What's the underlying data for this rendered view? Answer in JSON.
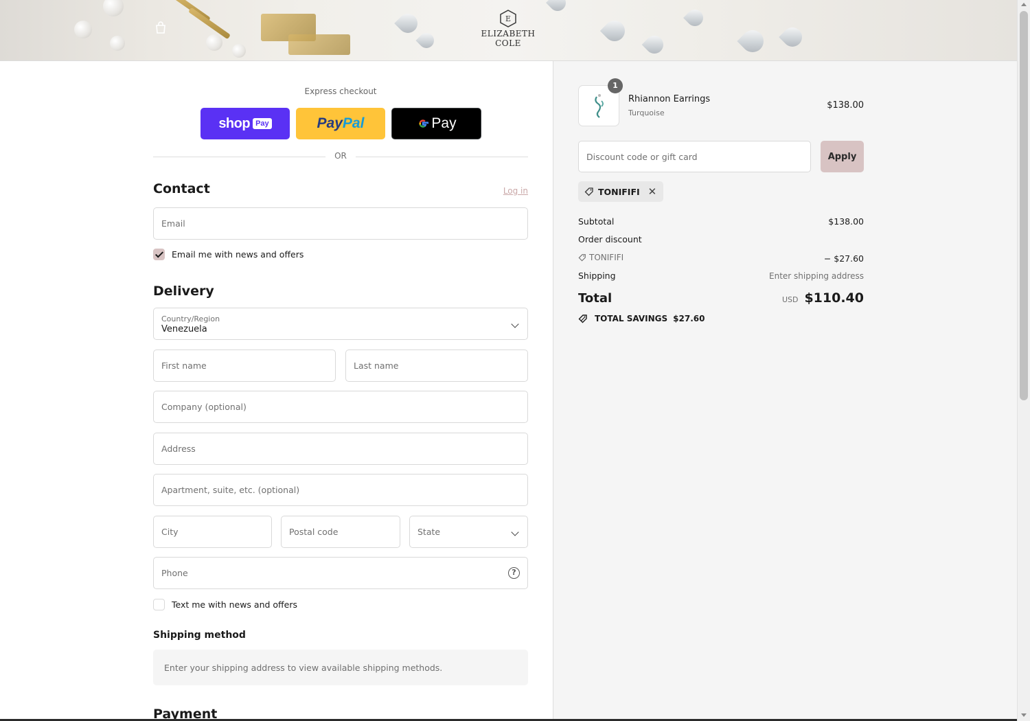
{
  "header": {
    "brand_name": "ELIZABETH COLE",
    "cart_icon": "shopping-bag-icon",
    "logo_icon": "hexagon-monogram-icon"
  },
  "express_checkout": {
    "label": "Express checkout",
    "shop_pay": {
      "text": "shop",
      "pill": "Pay"
    },
    "paypal": {
      "part1": "Pay",
      "part2": "Pal"
    },
    "google_pay": {
      "g": "G",
      "pay": "Pay"
    },
    "divider_text": "OR"
  },
  "contact": {
    "title": "Contact",
    "login_link": "Log in",
    "email_placeholder": "Email",
    "email_offers_label": "Email me with news and offers",
    "email_offers_checked": true
  },
  "delivery": {
    "title": "Delivery",
    "country_label": "Country/Region",
    "country_value": "Venezuela",
    "first_name_placeholder": "First name",
    "last_name_placeholder": "Last name",
    "company_placeholder": "Company (optional)",
    "address_placeholder": "Address",
    "apartment_placeholder": "Apartment, suite, etc. (optional)",
    "city_placeholder": "City",
    "postal_placeholder": "Postal code",
    "state_placeholder": "State",
    "phone_placeholder": "Phone",
    "phone_help_glyph": "?",
    "text_offers_label": "Text me with news and offers",
    "text_offers_checked": false
  },
  "shipping_method": {
    "title": "Shipping method",
    "message": "Enter your shipping address to view available shipping methods."
  },
  "payment": {
    "title": "Payment"
  },
  "order": {
    "item": {
      "name": "Rhiannon Earrings",
      "variant": "Turquoise",
      "price": "$138.00",
      "quantity": "1"
    },
    "discount_placeholder": "Discount code or gift card",
    "apply_label": "Apply",
    "applied_code": "TONIFIFI",
    "subtotal_label": "Subtotal",
    "subtotal_value": "$138.00",
    "order_discount_label": "Order discount",
    "discount_code": "TONIFIFI",
    "discount_value": "− $27.60",
    "shipping_label": "Shipping",
    "shipping_value": "Enter shipping address",
    "total_label": "Total",
    "currency": "USD",
    "total_value": "$110.40",
    "savings_label": "TOTAL SAVINGS",
    "savings_value": "$27.60"
  },
  "colors": {
    "shop_pay": "#5a31f4",
    "paypal": "#ffc439",
    "google_pay": "#000000",
    "accent": "#d8c3c3",
    "summary_background": "#f5f5f5"
  }
}
